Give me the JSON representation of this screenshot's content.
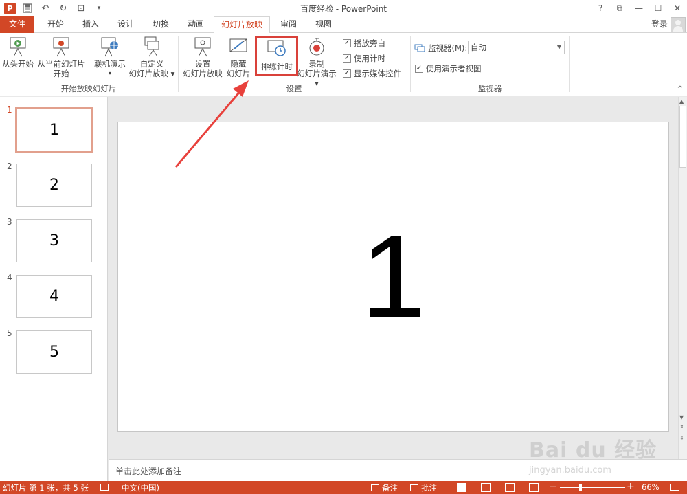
{
  "window": {
    "title": "百度经验 - PowerPoint",
    "help": "?",
    "restore": "⧉",
    "minimize": "—",
    "maximize": "☐",
    "close": "✕"
  },
  "qat": {
    "logo": "P",
    "save": "💾",
    "undo": "↶",
    "redo": "↻",
    "slideshow": "⊡",
    "more": "▾"
  },
  "tabs": [
    {
      "label": "文件"
    },
    {
      "label": "开始"
    },
    {
      "label": "插入"
    },
    {
      "label": "设计"
    },
    {
      "label": "切换"
    },
    {
      "label": "动画"
    },
    {
      "label": "幻灯片放映"
    },
    {
      "label": "审阅"
    },
    {
      "label": "视图"
    }
  ],
  "account": {
    "login": "登录"
  },
  "ribbon": {
    "start_group": {
      "label": "开始放映幻灯片",
      "from_beginning": "从头开始",
      "from_current_1": "从当前幻灯片",
      "from_current_2": "开始",
      "online_1": "联机演示",
      "online_2": "▾",
      "custom_1": "自定义",
      "custom_2": "幻灯片放映 ▾"
    },
    "setup_group": {
      "label": "设置",
      "setup_1": "设置",
      "setup_2": "幻灯片放映",
      "hide_1": "隐藏",
      "hide_2": "幻灯片",
      "rehearse": "排练计时",
      "record_1": "录制",
      "record_2": "幻灯片演示 ▾",
      "play_narration": "播放旁白",
      "use_timings": "使用计时",
      "show_media": "显示媒体控件"
    },
    "monitor_group": {
      "label": "监视器",
      "monitor_label": "监视器(M):",
      "monitor_value": "自动",
      "presenter_view": "使用演示者视图"
    },
    "collapse": "^"
  },
  "slides": [
    {
      "num": "1",
      "text": "1"
    },
    {
      "num": "2",
      "text": "2"
    },
    {
      "num": "3",
      "text": "3"
    },
    {
      "num": "4",
      "text": "4"
    },
    {
      "num": "5",
      "text": "5"
    }
  ],
  "current_slide_text": "1",
  "notes_placeholder": "单击此处添加备注",
  "statusbar": {
    "slide_info": "幻灯片 第 1 张，共 5 张",
    "language": "中文(中国)",
    "notes": "备注",
    "comments": "批注",
    "zoom_minus": "−",
    "zoom_plus": "+",
    "zoom": "66%"
  },
  "watermark": {
    "main": "Bai du 经验",
    "sub": "jingyan.baidu.com"
  },
  "colors": {
    "accent": "#d24726",
    "highlight": "#d9413a"
  }
}
